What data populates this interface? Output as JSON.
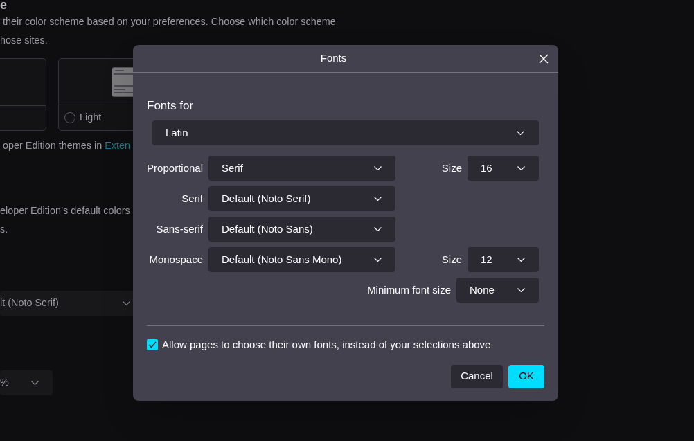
{
  "background_page": {
    "heading_fragment": "e",
    "description_lines": [
      "their color scheme based on your preferences. Choose which color scheme",
      "hose sites."
    ],
    "theme_cards": [
      {
        "label": "Light",
        "selected": false
      }
    ],
    "themes_note": {
      "text": "oper Edition themes in ",
      "link": "Exten"
    },
    "colors_note_lines": [
      "eloper Edition’s default colors",
      "s."
    ],
    "font_select": {
      "value": "lt (Noto Serif)"
    },
    "zoom_select": {
      "value": "%"
    }
  },
  "dialog": {
    "title": "Fonts",
    "fonts_for_label": "Fonts for",
    "language_select": {
      "value": "Latin"
    },
    "font_rows": [
      {
        "label": "Proportional",
        "value": "Serif",
        "size": {
          "label": "Size",
          "value": "16"
        }
      },
      {
        "label": "Serif",
        "value": "Default (Noto Serif)"
      },
      {
        "label": "Sans-serif",
        "value": "Default (Noto Sans)"
      },
      {
        "label": "Monospace",
        "value": "Default (Noto Sans Mono)",
        "size": {
          "label": "Size",
          "value": "12"
        }
      }
    ],
    "minimum_font_size": {
      "label": "Minimum font size",
      "value": "None"
    },
    "allow_page_fonts": {
      "label": "Allow pages to choose their own fonts, instead of your selections above",
      "checked": true
    },
    "buttons": [
      {
        "label": "Cancel",
        "kind": "secondary"
      },
      {
        "label": "OK",
        "kind": "primary"
      }
    ]
  }
}
